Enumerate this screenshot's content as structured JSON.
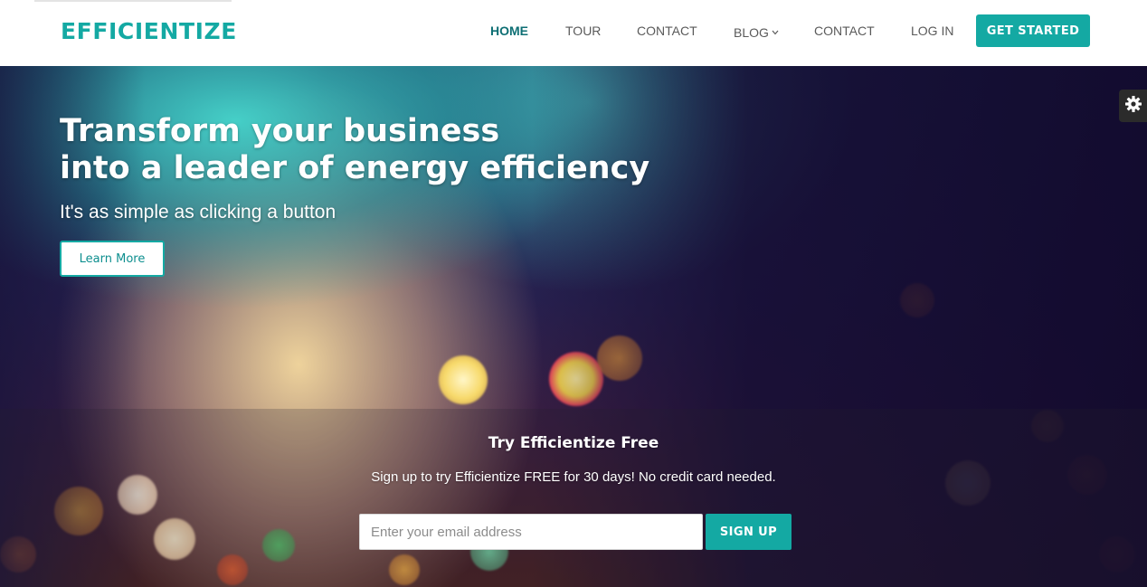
{
  "brand": {
    "name": "EFFICIENTIZE",
    "color": "#14a9a3"
  },
  "nav": {
    "items": [
      {
        "label": "HOME",
        "active": true
      },
      {
        "label": "TOUR"
      },
      {
        "label": "CONTACT"
      },
      {
        "label": "BLOG",
        "dropdown": true
      },
      {
        "label": "CONTACT"
      },
      {
        "label": "LOG IN"
      }
    ],
    "cta_label": "GET STARTED",
    "dropdown_icon": "chevron-down-icon"
  },
  "hero": {
    "headline_line1": "Transform your business",
    "headline_line2": "into a leader of energy efficiency",
    "subheadline": "It's as simple as clicking a button",
    "learn_more_label": "Learn More",
    "settings_icon": "gear-icon"
  },
  "signup": {
    "title": "Try Efficientize Free",
    "text": "Sign up to try Efficientize FREE for 30 days! No credit card needed.",
    "email_placeholder": "Enter your email address",
    "email_value": "",
    "button_label": "SIGN UP"
  }
}
